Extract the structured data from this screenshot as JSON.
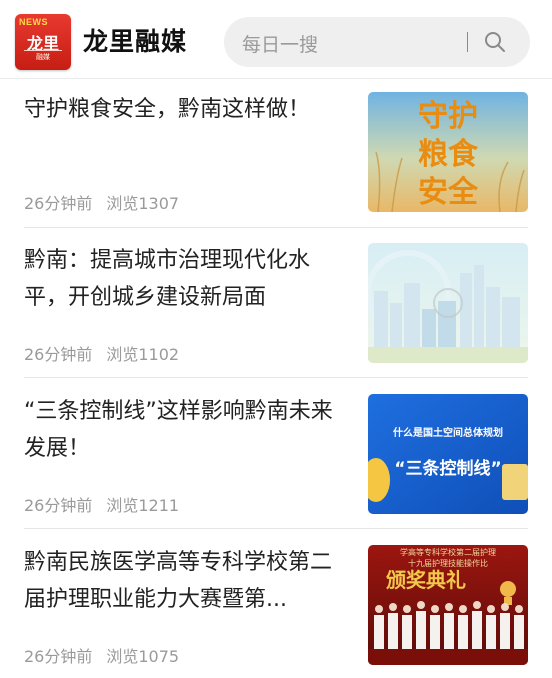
{
  "header": {
    "logo_badge": "NEWS",
    "logo_text": "龙里",
    "logo_sub": "融媒",
    "app_title": "龙里融媒",
    "search_placeholder": "每日一搜"
  },
  "articles": [
    {
      "title": "守护粮食安全，黔南这样做！",
      "time": "26分钟前",
      "views": "浏览1307",
      "thumb": {
        "chars": [
          "守护",
          "粮食",
          "安全"
        ]
      }
    },
    {
      "title": "黔南：提高城市治理现代化水平，开创城乡建设新局面",
      "time": "26分钟前",
      "views": "浏览1102",
      "thumb": {}
    },
    {
      "title": "“三条控制线”这样影响黔南未来发展！",
      "time": "26分钟前",
      "views": "浏览1211",
      "thumb": {
        "line1": "什么是国土空间总体规划",
        "line2": "“三条控制线”"
      }
    },
    {
      "title": "黔南民族医学高等专科学校第二届护理职业能力大赛暨第...",
      "time": "26分钟前",
      "views": "浏览1075",
      "thumb": {
        "banner": "学高等专科学校第二届护理",
        "banner2": "十九届护理技能操作比",
        "award": "颁奖典礼"
      }
    }
  ]
}
